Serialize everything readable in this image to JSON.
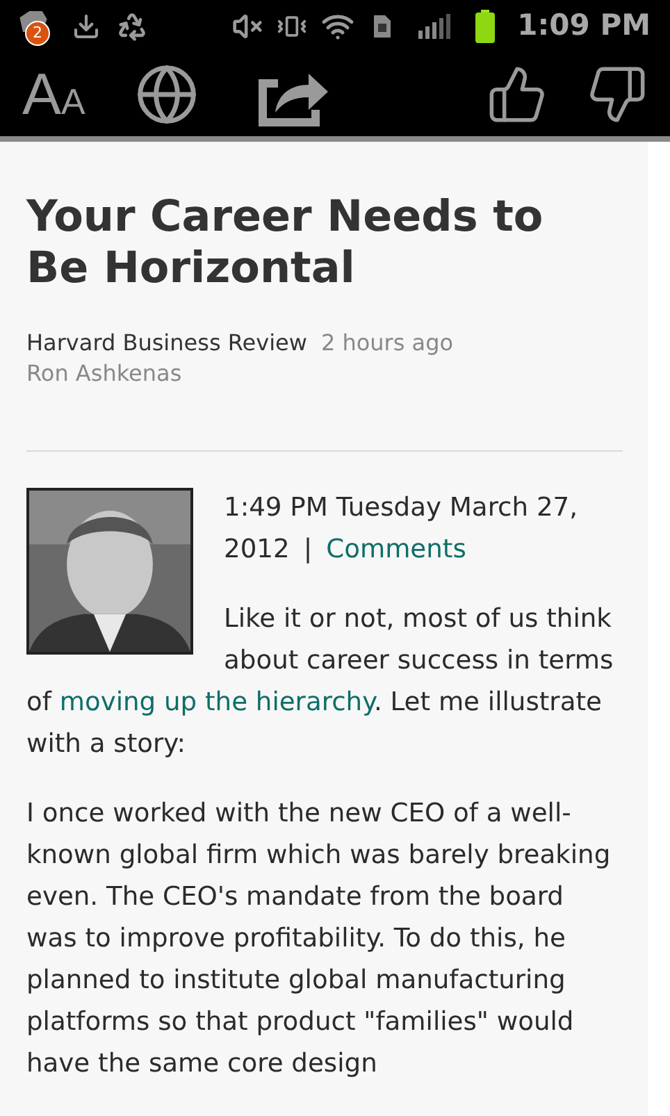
{
  "status_bar": {
    "notification_count": "2",
    "time": "1:09 PM"
  },
  "toolbar": {
    "font_button": "AA"
  },
  "article": {
    "title": "Your Career Needs to Be Horizontal",
    "source": "Harvard Business Review",
    "time_ago": "2 hours ago",
    "author": "Ron Ashkenas",
    "date": "1:49 PM Tuesday March 27, 2012",
    "separator": "|",
    "comments_link": "Comments",
    "paragraphs": [
      {
        "parts": [
          {
            "kind": "text",
            "text": "Like it or not, most of us think about career success in terms of "
          },
          {
            "kind": "link",
            "text": "moving up the hierarchy"
          },
          {
            "kind": "text",
            "text": ". Let me illustrate with a story:"
          }
        ]
      },
      {
        "parts": [
          {
            "kind": "text",
            "text": "I once worked with the new CEO of a well-known global firm which was barely breaking even. The CEO's mandate from the board was to improve profitability. To do this, he planned to institute global manufacturing platforms so that product \"families\" would have the same core design"
          }
        ]
      }
    ]
  }
}
